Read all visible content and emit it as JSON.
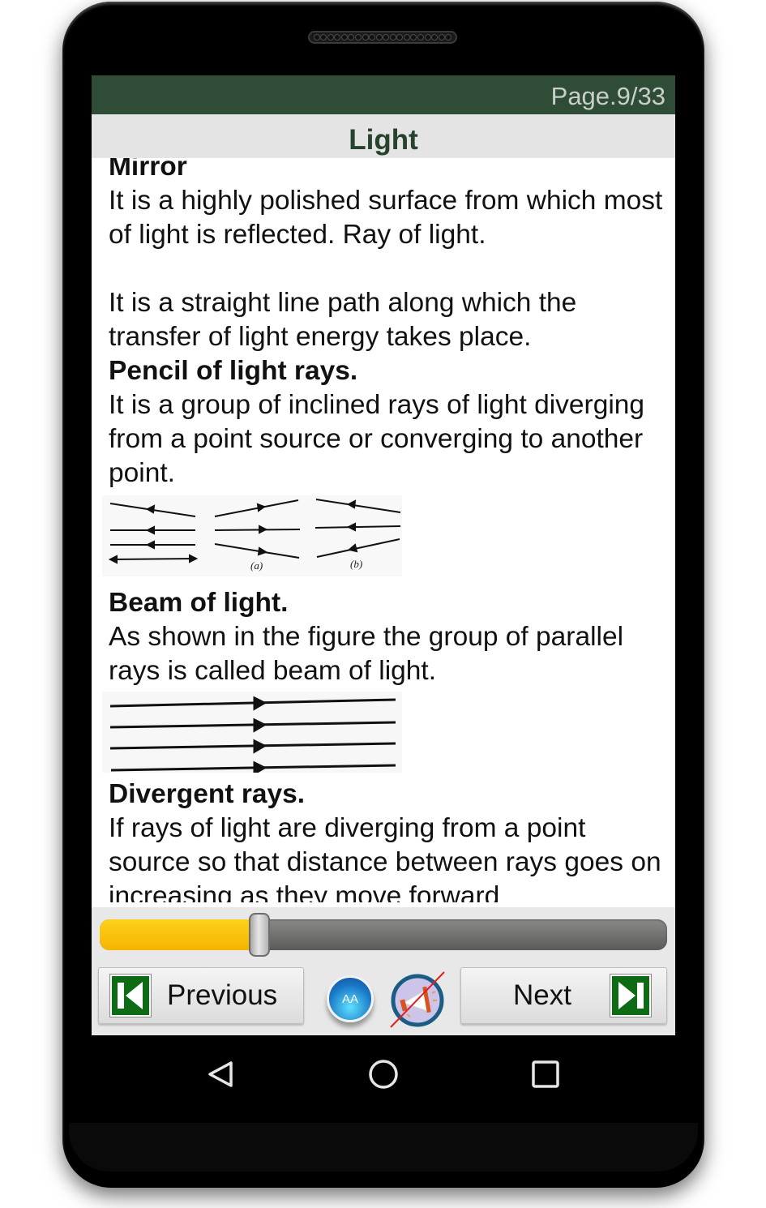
{
  "header": {
    "page_indicator": "Page.9/33",
    "title": "Light"
  },
  "content": {
    "partial_heading_top": "Mirror",
    "blocks": [
      {
        "type": "text",
        "text": "It is a highly polished surface from which most of light is reflected. Ray of light."
      },
      {
        "type": "text",
        "text": "It is a straight line path along which the transfer of light energy takes place."
      },
      {
        "type": "heading",
        "text": "Pencil of light rays."
      },
      {
        "type": "text",
        "text": "It is a group of inclined rays of light diverging from a point source or converging to another point."
      },
      {
        "type": "heading",
        "text": "Beam of light."
      },
      {
        "type": "text",
        "text": "As shown in the figure the group of parallel rays is called beam of light."
      },
      {
        "type": "heading",
        "text": "Divergent rays."
      },
      {
        "type": "text",
        "text": "If rays of light are diverging from a point source so that distance between rays goes on increasing as they move forward"
      }
    ],
    "figures": [
      {
        "name": "pencil-of-light-figure",
        "labels": [
          "(a)",
          "(b)"
        ]
      },
      {
        "name": "beam-of-light-figure",
        "labels": []
      }
    ]
  },
  "controls": {
    "page_slider": {
      "value": 9,
      "max": 33,
      "progress": 0.28
    },
    "previous_label": "Previous",
    "next_label": "Next",
    "font_size_label": "AA",
    "font_size_icon": "font-size-icon",
    "sound_icon": "sound-off-icon"
  },
  "system_nav": {
    "back": "back-triangle-icon",
    "home": "home-circle-icon",
    "recents": "recents-square-icon"
  }
}
